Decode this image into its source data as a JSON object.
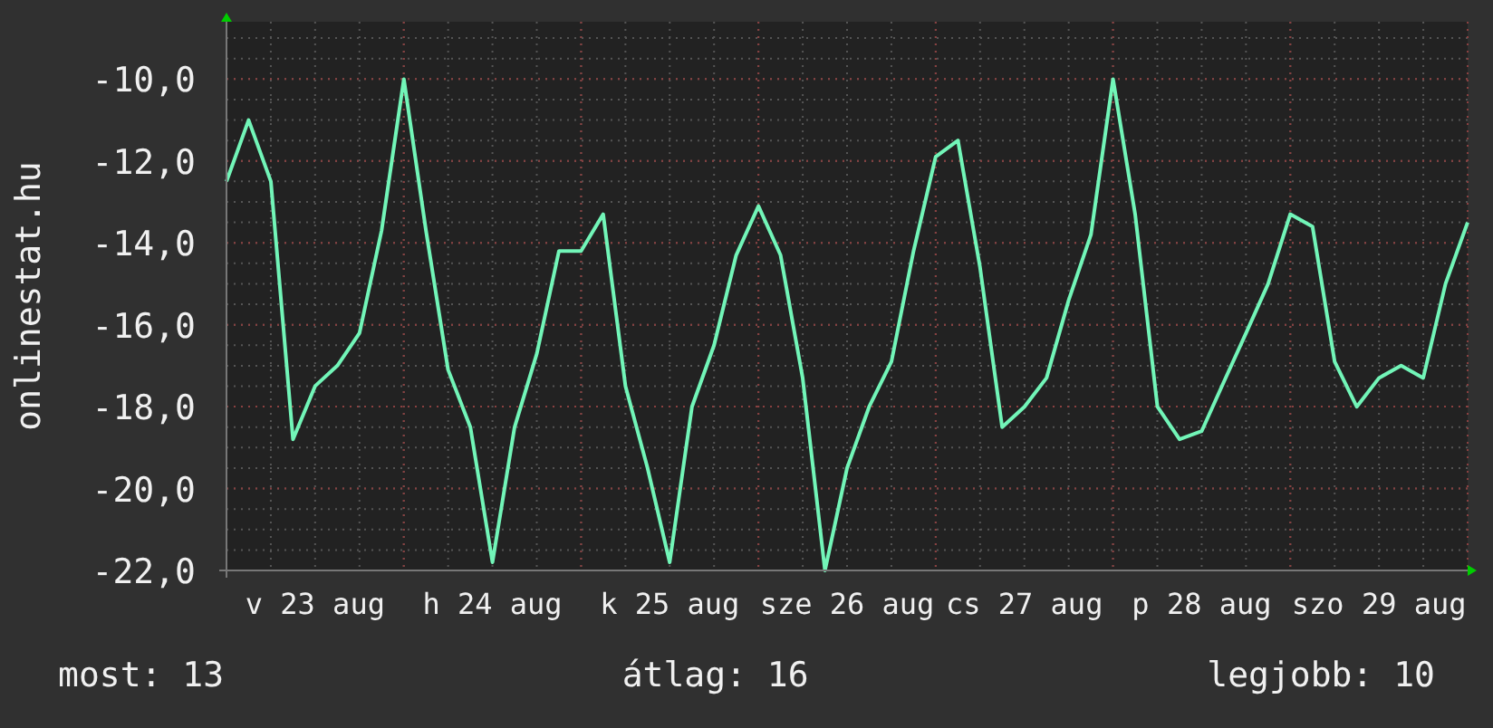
{
  "chart": {
    "chart_data": {
      "type": "line",
      "ylabel": "onlinestat.hu",
      "grid": true,
      "ylim": [
        -22,
        -8.6
      ],
      "yticks": [
        {
          "value": -10,
          "label": "-10,0"
        },
        {
          "value": -12,
          "label": "-12,0"
        },
        {
          "value": -14,
          "label": "-14,0"
        },
        {
          "value": -16,
          "label": "-16,0"
        },
        {
          "value": -18,
          "label": "-18,0"
        },
        {
          "value": -20,
          "label": "-20,0"
        },
        {
          "value": -22,
          "label": "-22,0"
        }
      ],
      "categories": [
        null,
        null,
        null,
        null,
        "v 23 aug",
        null,
        null,
        null,
        null,
        null,
        null,
        null,
        "h 24 aug",
        null,
        null,
        null,
        null,
        null,
        null,
        null,
        "k 25 aug",
        null,
        null,
        null,
        null,
        null,
        null,
        null,
        "sze 26 aug",
        null,
        null,
        null,
        null,
        null,
        null,
        null,
        "cs 27 aug",
        null,
        null,
        null,
        null,
        null,
        null,
        null,
        "p 28 aug",
        null,
        null,
        null,
        null,
        null,
        null,
        null,
        "szo 29 aug",
        null,
        null,
        null,
        null
      ],
      "series": [
        {
          "color": "#72f5b8",
          "values": [
            -12.5,
            -11,
            -12.5,
            -18.8,
            -17.5,
            -17,
            -16.2,
            -13.7,
            -10,
            -13.7,
            -17.1,
            -18.5,
            -21.8,
            -18.5,
            -16.7,
            -14.2,
            -14.2,
            -13.3,
            -17.5,
            -19.5,
            -21.8,
            -18,
            -16.5,
            -14.3,
            -13.1,
            -14.3,
            -17.3,
            -22,
            -19.5,
            -18,
            -16.9,
            -14.2,
            -11.9,
            -11.5,
            -14.6,
            -18.5,
            -18,
            -17.3,
            -15.4,
            -13.8,
            -10,
            -13.3,
            -18,
            -18.8,
            -18.6,
            -17.4,
            -16.2,
            -15,
            -13.3,
            -13.6,
            -16.9,
            -18,
            -17.3,
            -17,
            -17.3,
            -15,
            -13.5
          ]
        }
      ]
    }
  },
  "legend": [
    {
      "text": "most: 13"
    },
    {
      "text": "átlag: 16"
    },
    {
      "text": "legjobb: 10"
    }
  ]
}
